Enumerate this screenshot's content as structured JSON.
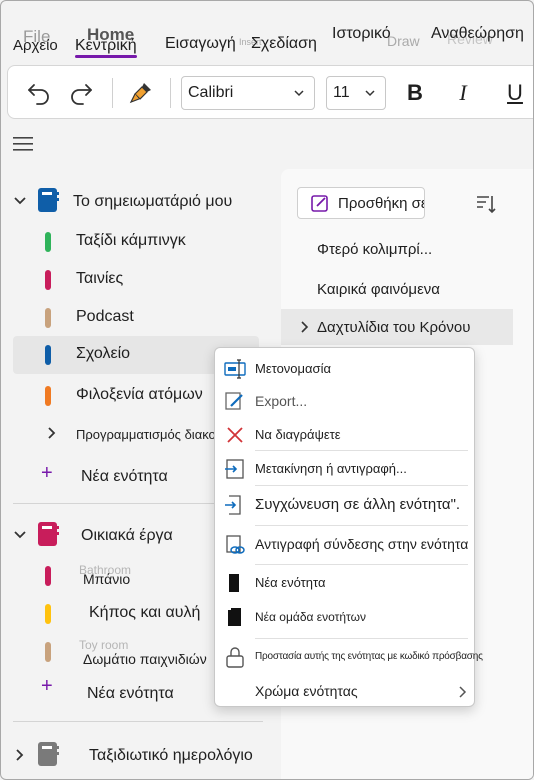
{
  "ribbon": {
    "ghost_tabs": [
      "File",
      "Home",
      "Insert",
      "Draw",
      "Review"
    ],
    "tabs": [
      "Αρχείο",
      "Κεντρική",
      "Εισαγωγή",
      "Σχεδίαση",
      "Ιστορικό",
      "Αναθεώρηση"
    ],
    "active_tab": "Κεντρική"
  },
  "toolbar": {
    "font_name": "Calibri",
    "font_size": "11",
    "bold": "B",
    "italic": "I",
    "underline": "U"
  },
  "notebooks": [
    {
      "name": "Το σημειωματάριό μου",
      "color": "#0f5ea8",
      "expanded": true,
      "sections": [
        {
          "label": "Ταξίδι κάμπινγκ",
          "color": "#2fb35a"
        },
        {
          "label": "Ταινίες",
          "color": "#c81d5b"
        },
        {
          "label": "Podcast",
          "color": "#c8a27d"
        },
        {
          "label": "Σχολείο",
          "color": "#0f5ea8",
          "selected": true
        },
        {
          "label": "Φιλοξενία ατόμων",
          "color": "#f07a22"
        }
      ],
      "group": "Προγραμματισμός διακοπών",
      "add_section": "Νέα ενότητα"
    },
    {
      "name": "Οικιακά έργα",
      "color": "#c81d5b",
      "expanded": true,
      "sections": [
        {
          "label": "Μπάνιο",
          "ghost": "Bathroom",
          "color": "#c81d5b"
        },
        {
          "label": "Κήπος και αυλή",
          "color": "#ffc20e"
        },
        {
          "label": "Δωμάτιο παιχνιδιών",
          "ghost": "Toy room",
          "color": "#c8a27d"
        }
      ],
      "add_section": "Νέα ενότητα"
    },
    {
      "name": "Ταξιδιωτικό ημερολόγιο",
      "color": "#7a7a7a",
      "expanded": false
    }
  ],
  "pages": {
    "add_page": "Προσθήκη σελίδας",
    "items": [
      {
        "label": "Φτερό κολιμπρί..."
      },
      {
        "label": "Καιρικά φαινόμενα"
      },
      {
        "label": "Δαχτυλίδια του Κρόνου",
        "selected": true
      }
    ]
  },
  "context_menu": {
    "items": [
      {
        "label": "Μετονομασία",
        "icon": "rename-icon"
      },
      {
        "label": "Export...",
        "icon": "export-icon"
      },
      {
        "label": "Να διαγράψετε",
        "icon": "delete-icon"
      },
      {
        "label": "Μετακίνηση ή αντιγραφή...",
        "icon": "move-copy-icon"
      },
      {
        "label": "Συγχώνευση σε άλλη ενότητα\".",
        "icon": "merge-icon"
      },
      {
        "label": "Αντιγραφή σύνδεσης στην ενότητα",
        "icon": "copy-link-icon"
      },
      {
        "label": "Νέα ενότητα",
        "icon": "new-section-icon"
      },
      {
        "label": "Νέα ομάδα ενοτήτων",
        "icon": "new-section-group-icon"
      },
      {
        "label": "Προστασία αυτής της ενότητας με κωδικό πρόσβασης",
        "icon": "lock-icon"
      },
      {
        "label": "Χρώμα ενότητας",
        "icon": "chevron-right-icon"
      }
    ]
  },
  "colors": {
    "accent": "#7719aa",
    "delete_icon": "#d13438",
    "icon_blue": "#0f6cbd"
  }
}
